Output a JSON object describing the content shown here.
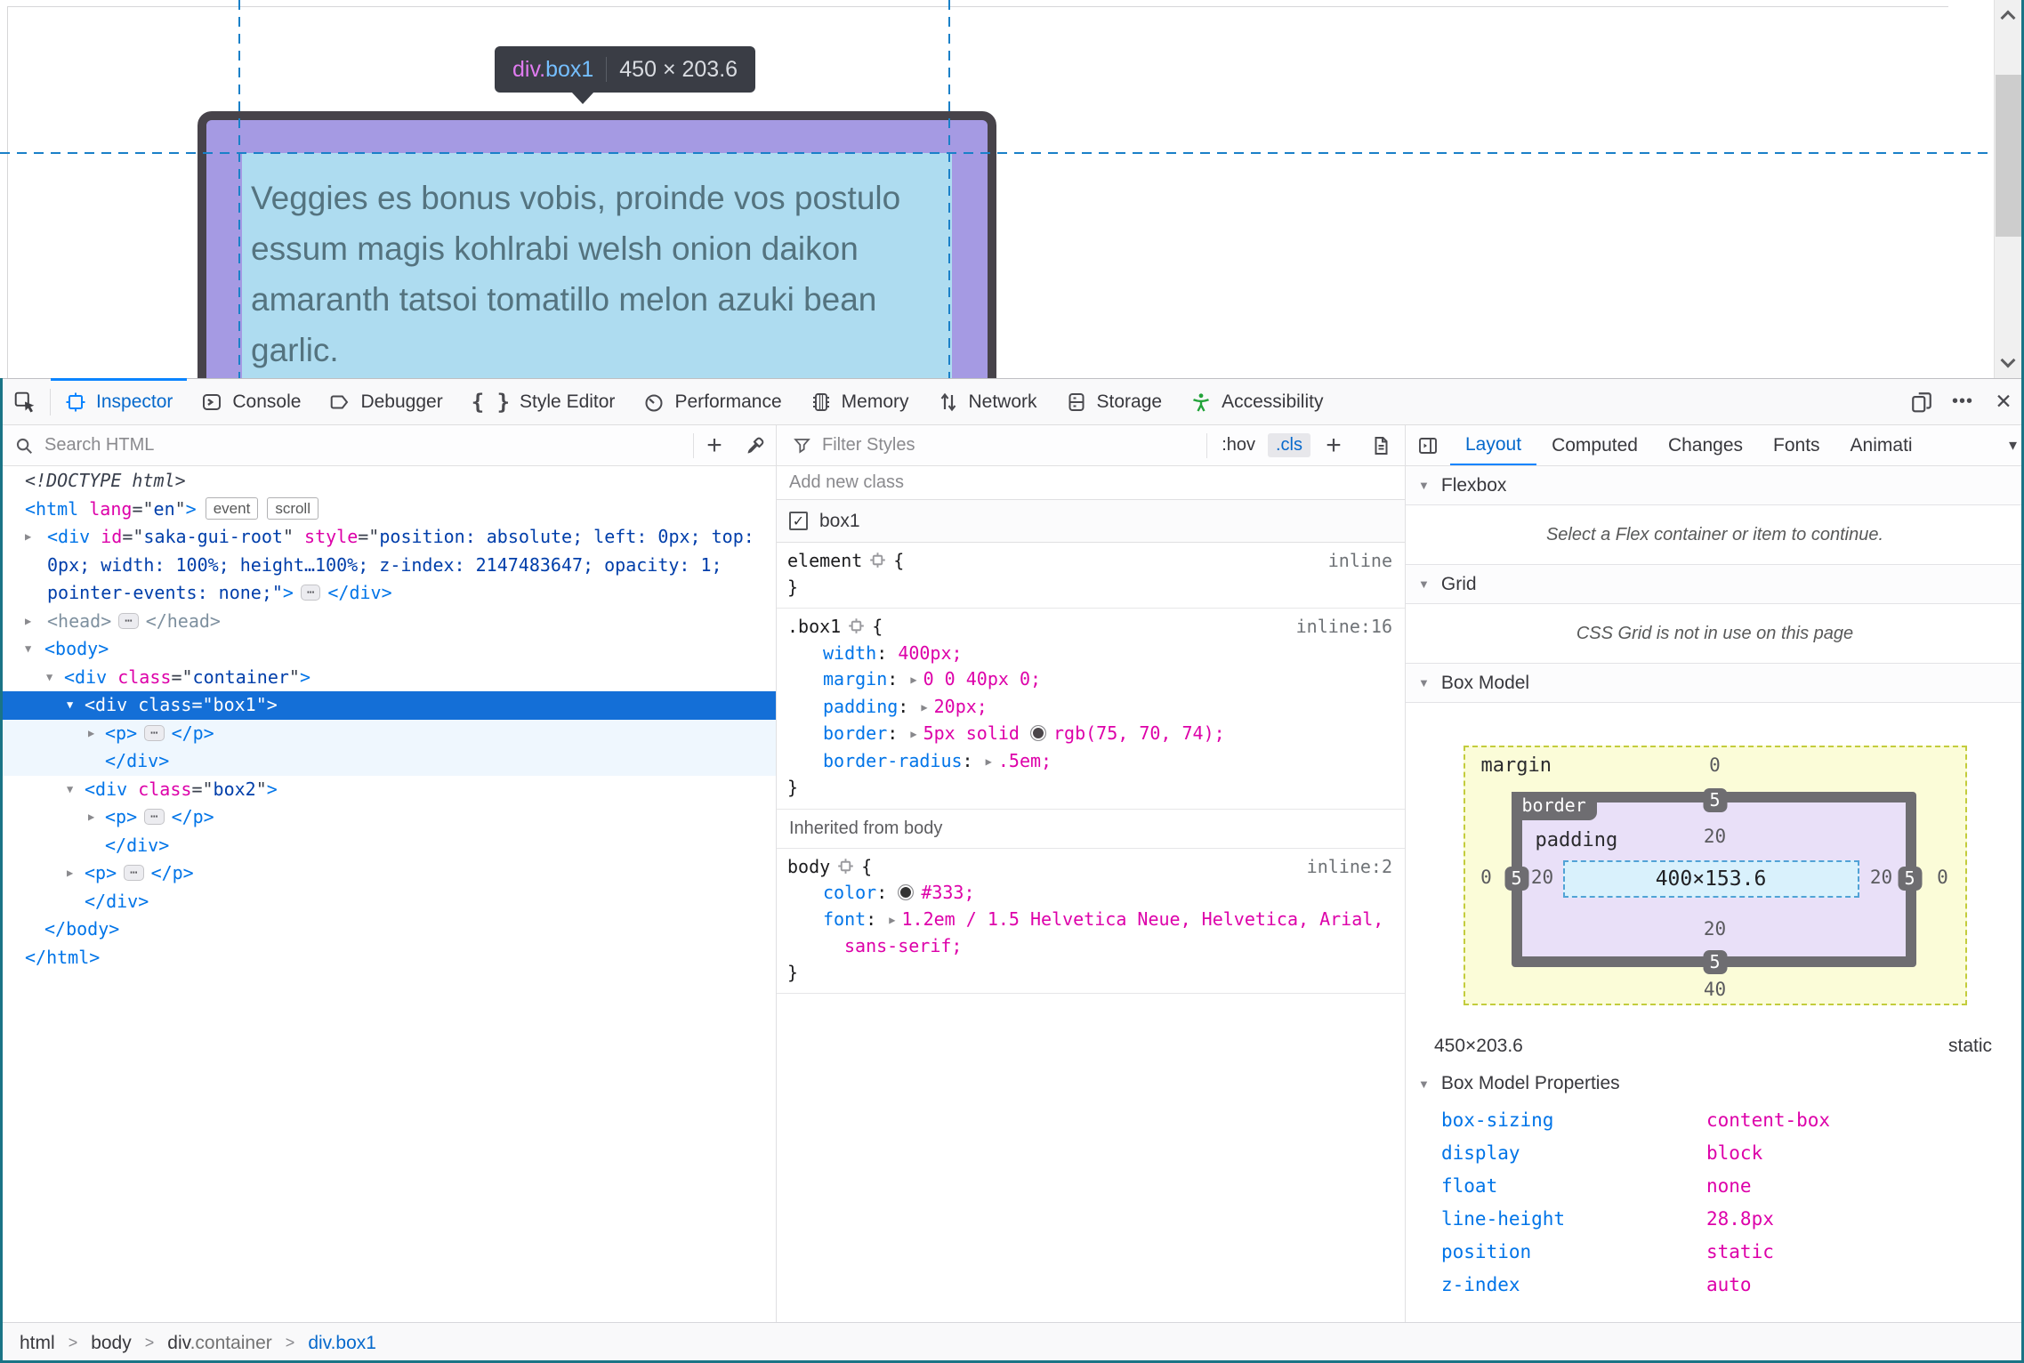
{
  "page": {
    "tooltip": {
      "selector_tag": "div.",
      "selector_class": "box1",
      "dims": "450 × 203.6"
    },
    "box_text_lines": [
      "Veggies es bonus vobis, proinde vos postulo",
      "essum magis kohlrabi welsh onion daikon",
      "amaranth tatsoi tomatillo melon azuki bean",
      "garlic."
    ]
  },
  "devtools": {
    "tabs": {
      "inspector": "Inspector",
      "console": "Console",
      "debugger": "Debugger",
      "style_editor": "Style Editor",
      "performance": "Performance",
      "memory": "Memory",
      "network": "Network",
      "storage": "Storage",
      "accessibility": "Accessibility"
    },
    "glyphs": {
      "close": "✕",
      "more": "•••",
      "caret": "▾",
      "plus": "+",
      "braces": "{ }",
      "crumb_sep": ">"
    },
    "markup": {
      "search_placeholder": "Search HTML",
      "rows": [
        {
          "xt": 28,
          "tok": [
            [
              "doct",
              "<!DOCTYPE html>"
            ]
          ]
        },
        {
          "xt": 28,
          "tok": [
            [
              "tg",
              "<html"
            ],
            [
              "pl",
              " "
            ],
            [
              "at",
              "lang"
            ],
            [
              "pl",
              "=\""
            ],
            [
              "vl",
              "en"
            ],
            [
              "pl",
              "\""
            ],
            [
              "tg",
              ">"
            ],
            [
              "bdg",
              "event"
            ],
            [
              "bdg",
              "scroll"
            ]
          ]
        },
        {
          "exp": "closed",
          "xe": 28,
          "xt": 53,
          "tok": [
            [
              "tg",
              "<div"
            ],
            [
              "pl",
              " "
            ],
            [
              "at",
              "id"
            ],
            [
              "pl",
              "=\""
            ],
            [
              "vl",
              "saka-gui-root"
            ],
            [
              "pl",
              "\" "
            ],
            [
              "at",
              "style"
            ],
            [
              "pl",
              "=\""
            ],
            [
              "vl",
              "position: absolute; left: 0px; top:"
            ]
          ]
        },
        {
          "xt": 53,
          "tok": [
            [
              "vl",
              "0px; width: 100%; height…100%; z-index: 2147483647; opacity: 1;"
            ]
          ]
        },
        {
          "xt": 53,
          "tok": [
            [
              "vl",
              "pointer-events: none;\""
            ],
            [
              "tg",
              ">"
            ],
            [
              "pill",
              "⋯"
            ],
            [
              "tg",
              "</div>"
            ]
          ]
        },
        {
          "exp": "closed",
          "xe": 28,
          "xt": 53,
          "tok": [
            [
              "dm",
              "<head>"
            ],
            [
              "pill",
              "⋯"
            ],
            [
              "dm",
              "</head>"
            ]
          ]
        },
        {
          "exp": "open",
          "xe": 28,
          "xt": 50,
          "tok": [
            [
              "tg",
              "<body>"
            ]
          ]
        },
        {
          "exp": "open",
          "xe": 52,
          "xt": 72,
          "tok": [
            [
              "tg",
              "<div"
            ],
            [
              "pl",
              " "
            ],
            [
              "at",
              "class"
            ],
            [
              "pl",
              "=\""
            ],
            [
              "vl",
              "container"
            ],
            [
              "pl",
              "\""
            ],
            [
              "tg",
              ">"
            ]
          ]
        },
        {
          "exp": "open",
          "xe": 75,
          "xt": 95,
          "bg": "sel",
          "tok": [
            [
              "tg",
              "<div"
            ],
            [
              "pl",
              " "
            ],
            [
              "at",
              "class"
            ],
            [
              "pl",
              "=\""
            ],
            [
              "vl",
              "box1"
            ],
            [
              "pl",
              "\""
            ],
            [
              "tg",
              ">"
            ]
          ]
        },
        {
          "exp": "closed",
          "xe": 99,
          "xt": 118,
          "bg": "shade",
          "tok": [
            [
              "tg",
              "<p>"
            ],
            [
              "pill",
              "⋯"
            ],
            [
              "tg",
              "</p>"
            ]
          ]
        },
        {
          "xt": 118,
          "bg": "shade",
          "tok": [
            [
              "tg",
              "</div>"
            ]
          ]
        },
        {
          "exp": "open",
          "xe": 75,
          "xt": 95,
          "tok": [
            [
              "tg",
              "<div"
            ],
            [
              "pl",
              " "
            ],
            [
              "at",
              "class"
            ],
            [
              "pl",
              "=\""
            ],
            [
              "vl",
              "box2"
            ],
            [
              "pl",
              "\""
            ],
            [
              "tg",
              ">"
            ]
          ]
        },
        {
          "exp": "closed",
          "xe": 99,
          "xt": 118,
          "tok": [
            [
              "tg",
              "<p>"
            ],
            [
              "pill",
              "⋯"
            ],
            [
              "tg",
              "</p>"
            ]
          ]
        },
        {
          "xt": 118,
          "tok": [
            [
              "tg",
              "</div>"
            ]
          ]
        },
        {
          "exp": "closed",
          "xe": 75,
          "xt": 95,
          "tok": [
            [
              "tg",
              "<p>"
            ],
            [
              "pill",
              "⋯"
            ],
            [
              "tg",
              "</p>"
            ]
          ]
        },
        {
          "xt": 95,
          "tok": [
            [
              "tg",
              "</div>"
            ]
          ]
        },
        {
          "xt": 50,
          "tok": [
            [
              "tg",
              "</body>"
            ]
          ]
        },
        {
          "xt": 28,
          "tok": [
            [
              "tg",
              "</html>"
            ]
          ]
        }
      ],
      "breadcrumbs": [
        {
          "parts": [
            {
              "text": "html",
              "style": "el"
            }
          ]
        },
        {
          "parts": [
            {
              "text": "body",
              "style": "el"
            }
          ]
        },
        {
          "parts": [
            {
              "text": "div",
              "style": "el"
            },
            {
              "text": ".container",
              "style": "muted"
            }
          ]
        },
        {
          "parts": [
            {
              "text": "div.box1",
              "style": "selected"
            }
          ]
        }
      ]
    },
    "rules": {
      "filter_placeholder": "Filter Styles",
      "hov_label": ":hov",
      "cls_label": ".cls",
      "add_class_placeholder": "Add new class",
      "class_toggles": [
        {
          "label": "box1",
          "checked": true
        }
      ],
      "groups": [
        {
          "rules": [
            {
              "selector": "element",
              "location": "inline",
              "decls": []
            }
          ]
        },
        {
          "rules": [
            {
              "selector": ".box1",
              "location": "inline:16",
              "decls": [
                {
                  "name": "width",
                  "value": [
                    {
                      "t": "400px;"
                    }
                  ]
                },
                {
                  "name": "margin",
                  "arrow": true,
                  "value": [
                    {
                      "t": "0 0 40px 0;"
                    }
                  ]
                },
                {
                  "name": "padding",
                  "arrow": true,
                  "value": [
                    {
                      "t": "20px;"
                    }
                  ]
                },
                {
                  "name": "border",
                  "arrow": true,
                  "value": [
                    {
                      "t": "5px solid "
                    },
                    {
                      "swatch": "#4b464a"
                    },
                    {
                      "t": "rgb(75, 70, 74);"
                    }
                  ]
                },
                {
                  "name": "border-radius",
                  "arrow": true,
                  "value": [
                    {
                      "t": ".5em;"
                    }
                  ]
                }
              ]
            }
          ]
        },
        {
          "header": "Inherited from body",
          "rules": [
            {
              "selector": "body",
              "location": "inline:2",
              "decls": [
                {
                  "name": "color",
                  "value": [
                    {
                      "swatch": "#333333"
                    },
                    {
                      "t": "#333;"
                    }
                  ]
                },
                {
                  "name": "font",
                  "arrow": true,
                  "value": [
                    {
                      "t": "1.2em / 1.5 Helvetica Neue, Helvetica, Arial,"
                    }
                  ],
                  "wrap": [
                    "sans-serif;"
                  ]
                }
              ]
            }
          ]
        }
      ]
    },
    "layout": {
      "tabs": [
        "Layout",
        "Computed",
        "Changes",
        "Fonts",
        "Animati"
      ],
      "flexbox_header": "Flexbox",
      "flexbox_message": "Select a Flex container or item to continue.",
      "grid_header": "Grid",
      "grid_message": "CSS Grid is not in use on this page",
      "box_model_header": "Box Model",
      "box_model": {
        "margin_label": "margin",
        "border_label": "border",
        "padding_label": "padding",
        "content_dims": "400×153.6",
        "margin": {
          "top": "0",
          "right": "0",
          "bottom": "40",
          "left": "0"
        },
        "border": {
          "top": "5",
          "right": "5",
          "bottom": "5",
          "left": "5"
        },
        "padding": {
          "top": "20",
          "right": "20",
          "bottom": "20",
          "left": "20"
        }
      },
      "element_dims": "450×203.6",
      "element_position": "static",
      "box_model_props_header": "Box Model Properties",
      "properties": [
        {
          "name": "box-sizing",
          "value": "content-box"
        },
        {
          "name": "display",
          "value": "block"
        },
        {
          "name": "float",
          "value": "none"
        },
        {
          "name": "line-height",
          "value": "28.8px"
        },
        {
          "name": "position",
          "value": "static"
        },
        {
          "name": "z-index",
          "value": "auto"
        }
      ]
    }
  }
}
